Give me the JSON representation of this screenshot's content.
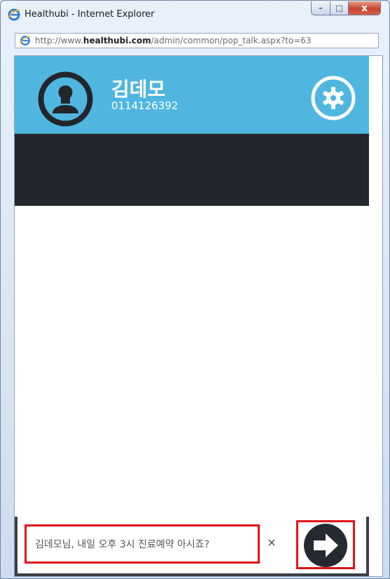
{
  "window": {
    "title": "Healthubi - Internet Explorer",
    "caption_min": "–",
    "caption_max": "□",
    "caption_close": "x"
  },
  "address": {
    "prefix": "http://www.",
    "host": "healthubi.com",
    "path": "/admin/common/pop_talk.aspx?to=63"
  },
  "profile": {
    "name": "김데모",
    "phone": "0114126392",
    "avatar_icon": "user-icon",
    "settings_icon": "gear-icon"
  },
  "compose": {
    "message": "김데모님, 내일 오후 3시 진료예약 아시죠?",
    "clear_label": "×",
    "send_icon": "arrow-right-icon"
  },
  "colors": {
    "header_bg": "#4fb6e0",
    "dark_bar": "#23262d",
    "highlight": "#e0121a"
  }
}
